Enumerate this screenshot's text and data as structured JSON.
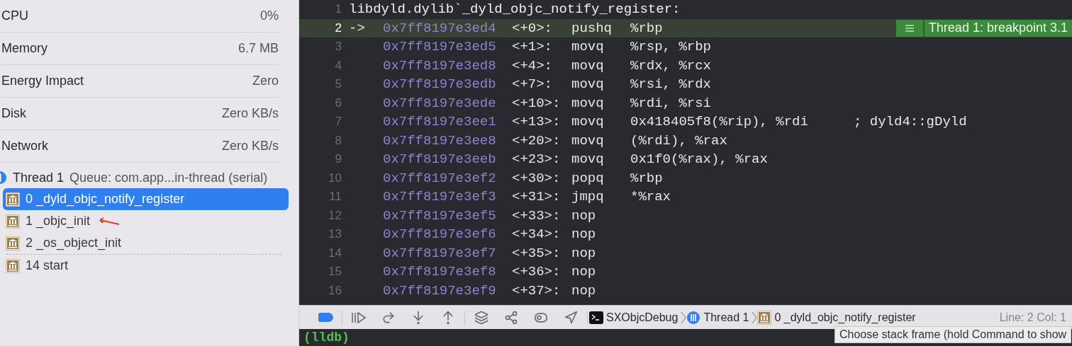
{
  "gauges": [
    {
      "label": "CPU",
      "value": "0%"
    },
    {
      "label": "Memory",
      "value": "6.7 MB"
    },
    {
      "label": "Energy Impact",
      "value": "Zero"
    },
    {
      "label": "Disk",
      "value": "Zero KB/s"
    },
    {
      "label": "Network",
      "value": "Zero KB/s"
    }
  ],
  "thread": {
    "name": "Thread 1",
    "queue": "Queue: com.app...in-thread (serial)"
  },
  "frames": [
    {
      "label": "0 _dyld_objc_notify_register",
      "selected": true,
      "annotated": false,
      "separator_after": false
    },
    {
      "label": "1 _objc_init",
      "selected": false,
      "annotated": true,
      "separator_after": false
    },
    {
      "label": "2 _os_object_init",
      "selected": false,
      "annotated": false,
      "separator_after": true
    },
    {
      "label": "14 start",
      "selected": false,
      "annotated": false,
      "separator_after": false
    }
  ],
  "code": [
    {
      "kind": "label",
      "line": "1",
      "text": "libdyld.dylib`_dyld_objc_notify_register:",
      "current": false
    },
    {
      "kind": "instr",
      "line": "2",
      "marker": "->",
      "address": "0x7ff8197e3ed4",
      "offset": "<+0>:",
      "mnemonic": "pushq",
      "operands": "%rbp",
      "current": true
    },
    {
      "kind": "instr",
      "line": "3",
      "address": "0x7ff8197e3ed5",
      "offset": "<+1>:",
      "mnemonic": "movq",
      "operands": "%rsp, %rbp",
      "current": false
    },
    {
      "kind": "instr",
      "line": "4",
      "address": "0x7ff8197e3ed8",
      "offset": "<+4>:",
      "mnemonic": "movq",
      "operands": "%rdx, %rcx",
      "current": false
    },
    {
      "kind": "instr",
      "line": "5",
      "address": "0x7ff8197e3edb",
      "offset": "<+7>:",
      "mnemonic": "movq",
      "operands": "%rsi, %rdx",
      "current": false
    },
    {
      "kind": "instr",
      "line": "6",
      "address": "0x7ff8197e3ede",
      "offset": "<+10>:",
      "mnemonic": "movq",
      "operands": "%rdi, %rsi",
      "current": false
    },
    {
      "kind": "instr",
      "line": "7",
      "address": "0x7ff8197e3ee1",
      "offset": "<+13>:",
      "mnemonic": "movq",
      "operands": "0x418405f8(%rip), %rdi",
      "comment": "; dyld4::gDyld",
      "current": false
    },
    {
      "kind": "instr",
      "line": "8",
      "address": "0x7ff8197e3ee8",
      "offset": "<+20>:",
      "mnemonic": "movq",
      "operands": "(%rdi), %rax",
      "current": false
    },
    {
      "kind": "instr",
      "line": "9",
      "address": "0x7ff8197e3eeb",
      "offset": "<+23>:",
      "mnemonic": "movq",
      "operands": "0x1f0(%rax), %rax",
      "current": false
    },
    {
      "kind": "instr",
      "line": "10",
      "address": "0x7ff8197e3ef2",
      "offset": "<+30>:",
      "mnemonic": "popq",
      "operands": "%rbp",
      "current": false
    },
    {
      "kind": "instr",
      "line": "11",
      "address": "0x7ff8197e3ef3",
      "offset": "<+31>:",
      "mnemonic": "jmpq",
      "operands": "*%rax",
      "current": false
    },
    {
      "kind": "instr",
      "line": "12",
      "address": "0x7ff8197e3ef5",
      "offset": "<+33>:",
      "mnemonic": "nop",
      "current": false
    },
    {
      "kind": "instr",
      "line": "13",
      "address": "0x7ff8197e3ef6",
      "offset": "<+34>:",
      "mnemonic": "nop",
      "current": false
    },
    {
      "kind": "instr",
      "line": "14",
      "address": "0x7ff8197e3ef7",
      "offset": "<+35>:",
      "mnemonic": "nop",
      "current": false
    },
    {
      "kind": "instr",
      "line": "15",
      "address": "0x7ff8197e3ef8",
      "offset": "<+36>:",
      "mnemonic": "nop",
      "current": false
    },
    {
      "kind": "instr",
      "line": "16",
      "address": "0x7ff8197e3ef9",
      "offset": "<+37>:",
      "mnemonic": "nop",
      "current": false
    }
  ],
  "breakpoint_badge": "Thread 1: breakpoint 3.1",
  "debug_bar": {
    "breakpoints_on": true,
    "breadcrumb": [
      "SXObjcDebug",
      "Thread 1",
      "0 _dyld_objc_notify_register"
    ],
    "position": "Line: 2  Col: 1"
  },
  "tooltip": "Choose stack frame (hold Command to show",
  "console": {
    "prompt": "(lldb)"
  }
}
